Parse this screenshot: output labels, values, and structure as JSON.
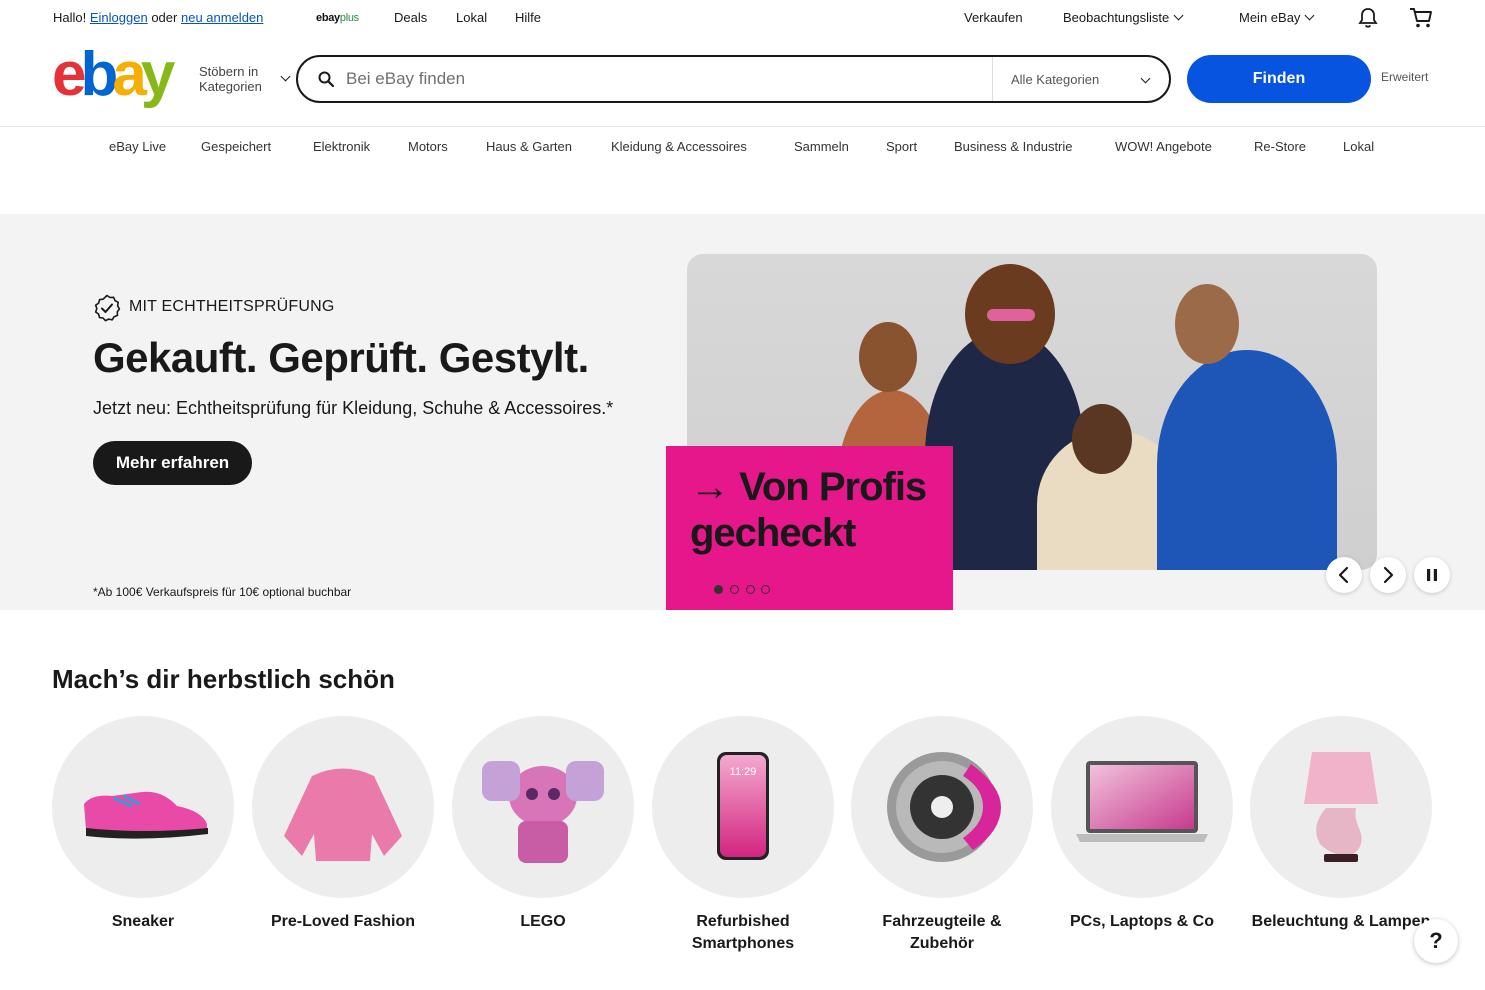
{
  "topbar": {
    "greeting": "Hallo!",
    "login_link": "Einloggen",
    "or_text": "oder",
    "register_link": "neu anmelden",
    "ebayplus_a": "ebay",
    "ebayplus_b": "plus",
    "deals": "Deals",
    "local": "Lokal",
    "help": "Hilfe",
    "sell": "Verkaufen",
    "watchlist": "Beobachtungsliste",
    "my_ebay": "Mein eBay"
  },
  "header": {
    "logo": [
      "e",
      "b",
      "a",
      "y"
    ],
    "browse_line1": "Stöbern in",
    "browse_line2": "Kategorien",
    "search_placeholder": "Bei eBay finden",
    "category_selected": "Alle Kategorien",
    "find_button": "Finden",
    "advanced": "Erweitert"
  },
  "nav": {
    "items": [
      "eBay Live",
      "Gespeichert",
      "Elektronik",
      "Motors",
      "Haus & Garten",
      "Kleidung & Accessoires",
      "Sammeln",
      "Sport",
      "Business & Industrie",
      "WOW! Angebote",
      "Re-Store",
      "Lokal"
    ]
  },
  "hero": {
    "badge": "MIT ECHTHEITSPRÜFUNG",
    "title": "Gekauft. Geprüft. Gestylt.",
    "subtitle": "Jetzt neu: Echtheitsprüfung für Kleidung, Schuhe & Accessoires.*",
    "cta": "Mehr erfahren",
    "footnote": "*Ab 100€ Verkaufspreis für 10€ optional buchbar",
    "card_arrow": "→",
    "card_line1": "Von Profis",
    "card_line2": "gecheckt",
    "slide_count": 4,
    "active_slide": 1
  },
  "section": {
    "title": "Mach’s dir herbstlich schön",
    "tiles": [
      {
        "label_1": "Sneaker",
        "label_2": ""
      },
      {
        "label_1": "Pre-Loved Fashion",
        "label_2": ""
      },
      {
        "label_1": "LEGO",
        "label_2": ""
      },
      {
        "label_1": "Refurbished",
        "label_2": "Smartphones"
      },
      {
        "label_1": "Fahrzeugteile &",
        "label_2": "Zubehör"
      },
      {
        "label_1": "PCs, Laptops & Co",
        "label_2": ""
      },
      {
        "label_1": "Beleuchtung & Lampen",
        "label_2": ""
      }
    ],
    "phone_time": "11:29"
  },
  "help": "?",
  "colors": {
    "brand_blue": "#0654e0",
    "hero_pink": "#e5178a",
    "logo_red": "#e53238",
    "logo_blue": "#0064d2",
    "logo_yellow": "#f5af02",
    "logo_green": "#86b817"
  }
}
